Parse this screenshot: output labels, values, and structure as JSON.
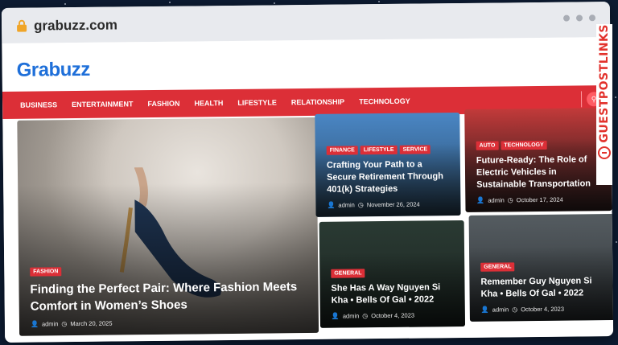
{
  "browser": {
    "url": "grabuzz.com"
  },
  "site": {
    "logo": "Grabuzz",
    "nav": [
      "BUSINESS",
      "ENTERTAINMENT",
      "FASHION",
      "HEALTH",
      "LIFESTYLE",
      "RELATIONSHIP",
      "TECHNOLOGY"
    ]
  },
  "articles": [
    {
      "tags": [
        "FASHION"
      ],
      "title": "Finding the Perfect Pair: Where Fashion Meets Comfort in Women’s Shoes",
      "author": "admin",
      "date": "March 20, 2025"
    },
    {
      "tags": [
        "FINANCE",
        "LIFESTYLE",
        "SERVICE"
      ],
      "title": "Crafting Your Path to a Secure Retirement Through 401(k) Strategies",
      "author": "admin",
      "date": "November 26, 2024"
    },
    {
      "tags": [
        "AUTO",
        "TECHNOLOGY"
      ],
      "title": "Future-Ready: The Role of Electric Vehicles in Sustainable Transportation",
      "author": "admin",
      "date": "October 17, 2024"
    },
    {
      "tags": [
        "GENERAL"
      ],
      "title": "She Has A Way Nguyen Si Kha • Bells Of Gal • 2022",
      "author": "admin",
      "date": "October 4, 2023"
    },
    {
      "tags": [
        "GENERAL"
      ],
      "title": "Remember Guy Nguyen Si Kha • Bells Of Gal • 2022",
      "author": "admin",
      "date": "October 4, 2023"
    }
  ],
  "watermark": {
    "text": "GUESTPOSTLINKS"
  },
  "icons": {
    "lock": "lock-icon",
    "author": "user-icon",
    "date": "clock-icon",
    "search": "search-icon"
  },
  "colors": {
    "brand_red": "#dc2f37",
    "logo_blue": "#1e6fd9"
  }
}
